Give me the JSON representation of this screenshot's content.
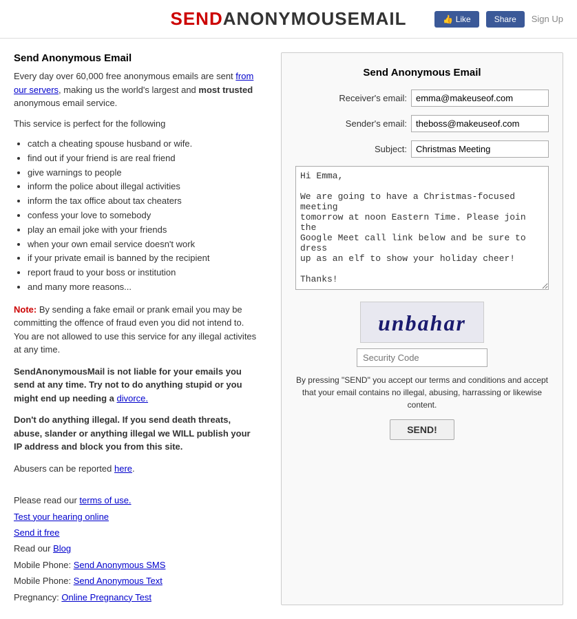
{
  "header": {
    "logo_send": "SEND",
    "logo_rest": "ANONYMOUSEMAIL",
    "like_label": "👍 Like",
    "share_label": "Share",
    "signup_label": "Sign Up"
  },
  "left": {
    "title": "Send Anonymous Email",
    "intro": "Every day over 60,000 free anonymous emails are sent from our servers, making us the world's largest and most trusted anonymous email service.",
    "intro_link_text": "from our servers",
    "perfect_intro": "This service is perfect for the following",
    "bullets": [
      "catch a cheating spouse husband or wife.",
      "find out if your friend is are real friend",
      "give warnings to people",
      "inform the police about illegal activities",
      "inform the tax office about tax cheaters",
      "confess your love to somebody",
      "play an email joke with your friends",
      "when your own email service doesn't work",
      "if your private email is banned by the recipient",
      "report fraud to your boss or institution",
      "and many more reasons..."
    ],
    "note_label": "Note:",
    "note_text": " By sending a fake email or prank email you may be committing the offence of fraud even you did not intend to. You are not allowed to use this service for any illegal activites at any time.",
    "liability_text": "SendAnonymousMail is not liable for your emails you send at any time. Try not to do anything stupid or you might end up needing a ",
    "liability_link": "divorce.",
    "illegal_text": "Don't do anything illegal. If you send death threats, abuse, slander or anything illegal we WILL publish your IP address and block you from this site.",
    "abusers_text": "Abusers can be reported ",
    "abusers_link": "here",
    "links": [
      {
        "text": "Please read our ",
        "link_text": "terms of use.",
        "href": "#"
      },
      {
        "text": "Test your hearing online",
        "href": "#"
      },
      {
        "text": "Send it free",
        "href": "#"
      },
      {
        "text": "Read our ",
        "link_text": "Blog",
        "href": "#"
      },
      {
        "text": "Mobile Phone: ",
        "link_text": "Send Anonymous SMS",
        "href": "#"
      },
      {
        "text": "Mobile Phone: ",
        "link_text": "Send Anonymous Text",
        "href": "#"
      },
      {
        "text": "Pregnancy: ",
        "link_text": "Online Pregnancy Test",
        "href": "#"
      }
    ]
  },
  "form": {
    "title": "Send Anonymous Email",
    "receiver_label": "Receiver's email:",
    "receiver_value": "emma@makeuseof.com",
    "sender_label": "Sender's email:",
    "sender_value": "theboss@makeuseof.com",
    "subject_label": "Subject:",
    "subject_value": "Christmas Meeting",
    "message_value": "Hi Emma,\n\nWe are going to have a Christmas-focused meeting\ntomorrow at noon Eastern Time. Please join the\nGoogle Meet call link below and be sure to dress\nup as an elf to show your holiday cheer!\n\nThanks!\n\n- The Boss",
    "captcha_text": "unbahar",
    "security_label": "Security Code",
    "terms_text": "By pressing \"SEND\" you accept our terms and conditions and accept that your email contains no illegal, abusing, harrassing or likewise content.",
    "send_label": "SEND!"
  }
}
